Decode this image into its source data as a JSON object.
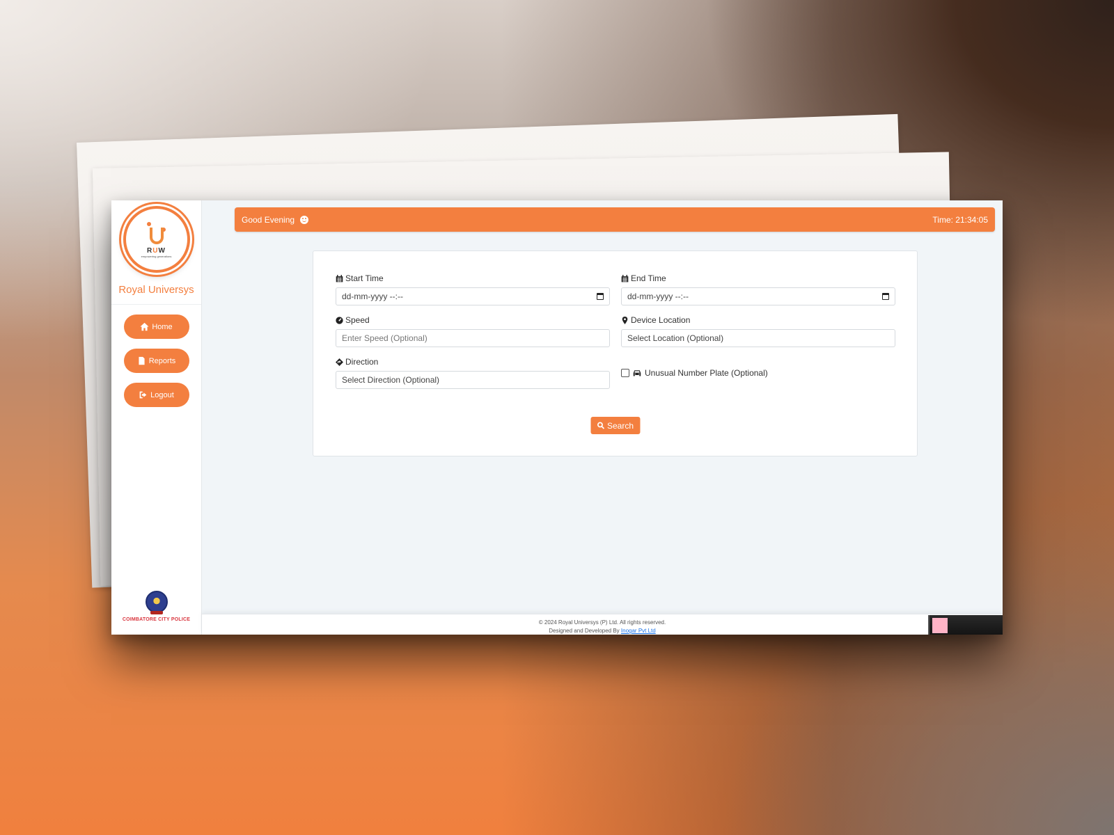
{
  "brand": {
    "logo_text": "RUW",
    "logo_tagline": "empowering generations",
    "name": "Royal Universys"
  },
  "sidebar": {
    "items": [
      {
        "label": "Home",
        "icon": "home-icon"
      },
      {
        "label": "Reports",
        "icon": "file-icon"
      },
      {
        "label": "Logout",
        "icon": "logout-icon"
      }
    ],
    "footer_logo_text": "COIMBATORE CITY POLICE"
  },
  "header": {
    "greeting": "Good Evening",
    "greeting_icon": "smile-icon",
    "time_label": "Time: 21:34:05"
  },
  "form": {
    "start_time": {
      "label": "Start Time",
      "icon": "calendar-icon",
      "placeholder": "dd-mm-yyyy --:--"
    },
    "end_time": {
      "label": "End Time",
      "icon": "calendar-icon",
      "placeholder": "dd-mm-yyyy --:--"
    },
    "speed": {
      "label": "Speed",
      "icon": "tachometer-icon",
      "placeholder": "Enter Speed (Optional)"
    },
    "device_location": {
      "label": "Device Location",
      "icon": "map-marker-icon",
      "value": "Select Location (Optional)"
    },
    "direction": {
      "label": "Direction",
      "icon": "direction-icon",
      "value": "Select Direction (Optional)"
    },
    "unusual_plate": {
      "label": "Unusual Number Plate (Optional)",
      "icon": "car-icon",
      "checked": false
    },
    "search_label": "Search"
  },
  "footer": {
    "copyright": "© 2024 Royal Universys (P) Ltd. All rights reserved.",
    "developed_prefix": "Designed and Developed By ",
    "developer_link": "Inogar Pvt Ltd"
  },
  "colors": {
    "accent": "#f37f3f",
    "page_bg": "#f1f5f8"
  }
}
